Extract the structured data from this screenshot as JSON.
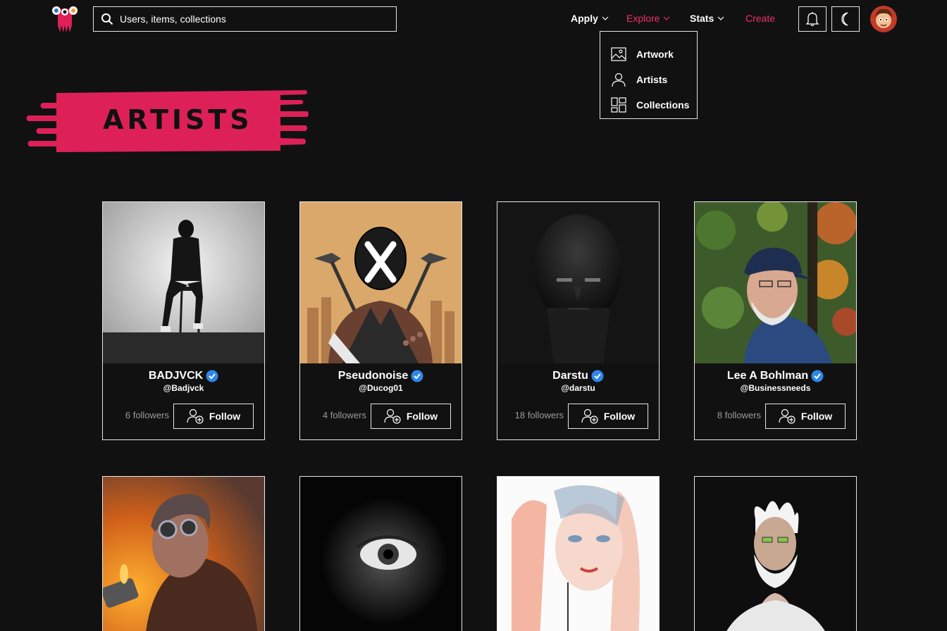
{
  "header": {
    "search_placeholder": "Users, items, collections",
    "nav": {
      "apply": "Apply",
      "explore": "Explore",
      "stats": "Stats",
      "create": "Create"
    },
    "accent_color": "#e8326a"
  },
  "explore_menu": {
    "items": [
      {
        "label": "Artwork",
        "icon": "artwork-icon"
      },
      {
        "label": "Artists",
        "icon": "person-icon"
      },
      {
        "label": "Collections",
        "icon": "grid-icon"
      }
    ]
  },
  "banner": {
    "title": "ARTISTS",
    "color": "#dd2158"
  },
  "artists": [
    {
      "name": "BADJVCK",
      "handle": "@Badjvck",
      "followers": "6 followers",
      "follow_label": "Follow",
      "verified": true
    },
    {
      "name": "Pseudonoise",
      "handle": "@Ducog01",
      "followers": "4 followers",
      "follow_label": "Follow",
      "verified": true
    },
    {
      "name": "Darstu",
      "handle": "@darstu",
      "followers": "18 followers",
      "follow_label": "Follow",
      "verified": true
    },
    {
      "name": "Lee A Bohlman",
      "handle": "@Businessneeds",
      "followers": "8 followers",
      "follow_label": "Follow",
      "verified": true
    }
  ]
}
